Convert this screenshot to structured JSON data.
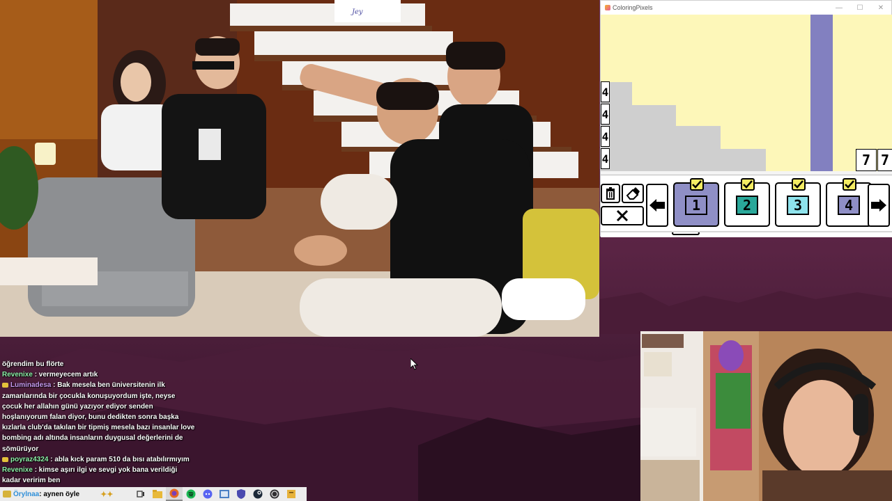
{
  "video": {
    "sign_text": "Jey\nSeni ❤"
  },
  "coloring_app": {
    "title": "ColoringPixels",
    "window_controls": [
      "—",
      "☐",
      "✕"
    ],
    "pixel_numbers_left": [
      "4",
      "4",
      "4",
      "4"
    ],
    "pixel_numbers_right": [
      "7",
      "7"
    ],
    "colors": {
      "canvas_bg": "#fdf7b9",
      "stair_gray": "#cfcfcf",
      "purple_column": "#8280c0",
      "selected_swatch": "#8f8fc6"
    },
    "swatches": [
      {
        "number": "1",
        "color": "#8f8fc6",
        "selected": true,
        "completed": true
      },
      {
        "number": "2",
        "color": "#2aa89a",
        "selected": false,
        "completed": true
      },
      {
        "number": "3",
        "color": "#8ee3ec",
        "selected": false,
        "completed": true
      },
      {
        "number": "4",
        "color": "#8f8fc6",
        "selected": false,
        "completed": true
      }
    ],
    "tools": [
      "trash-icon",
      "eraser-icon",
      "close-icon"
    ]
  },
  "chat": {
    "messages": [
      {
        "user": "",
        "user_color": "#ffffff",
        "badge": false,
        "text": "öğrendim bu flörte"
      },
      {
        "user": "Revenixe",
        "user_color": "#8df0a8",
        "badge": false,
        "text": ": vermeyecem artık"
      },
      {
        "user": "Luminadesa",
        "user_color": "#c99bf2",
        "badge": true,
        "text": ": Bak mesela ben üniversitenin ilk zamanlarında bir çocukla konuşuyordum işte, neyse çocuk her allahın günü yazıyor ediyor senden hoşlanıyorum falan diyor, bunu dedikten sonra başka kızlarla club'da takılan bir tipmiş mesela bazı insanlar love bombing adı altında insanların duygusal değerlerini de sömürüyor"
      },
      {
        "user": "poyraz4324",
        "user_color": "#8df0a8",
        "badge": true,
        "text": ": abla kıck param 510 da bısı atabılırmıyım"
      },
      {
        "user": "Revenixe",
        "user_color": "#8df0a8",
        "badge": false,
        "text": ": kimse aşırı ilgi ve sevgi yok bana verildiği kadar veririm ben"
      }
    ]
  },
  "taskbar": {
    "chat_user": "Örylnaa",
    "chat_text": ": aynen öyle",
    "chat_user_color": "#2f8fd8",
    "apps": [
      "task-view-icon",
      "file-explorer-icon",
      "firefox-icon",
      "spotify-icon",
      "discord-icon",
      "folder-icon",
      "shield-icon",
      "steam-icon",
      "obs-icon",
      "sticky-app-icon"
    ]
  }
}
